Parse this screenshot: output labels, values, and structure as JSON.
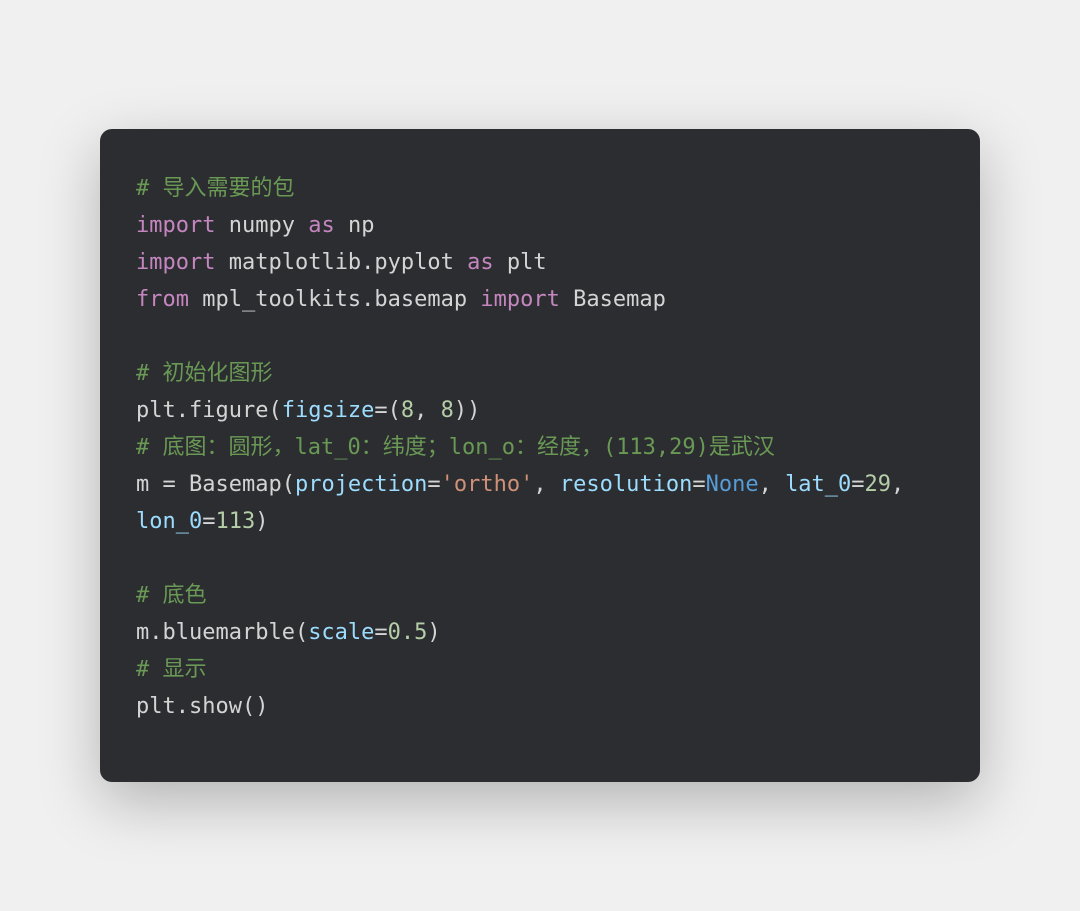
{
  "code": {
    "lines": [
      {
        "tokens": [
          {
            "cls": "comment",
            "text": "# 导入需要的包"
          }
        ]
      },
      {
        "tokens": [
          {
            "cls": "keyword",
            "text": "import"
          },
          {
            "cls": "default",
            "text": " numpy "
          },
          {
            "cls": "keyword",
            "text": "as"
          },
          {
            "cls": "default",
            "text": " np"
          }
        ]
      },
      {
        "tokens": [
          {
            "cls": "keyword",
            "text": "import"
          },
          {
            "cls": "default",
            "text": " matplotlib.pyplot "
          },
          {
            "cls": "keyword",
            "text": "as"
          },
          {
            "cls": "default",
            "text": " plt"
          }
        ]
      },
      {
        "tokens": [
          {
            "cls": "keyword",
            "text": "from"
          },
          {
            "cls": "default",
            "text": " mpl_toolkits.basemap "
          },
          {
            "cls": "keyword",
            "text": "import"
          },
          {
            "cls": "default",
            "text": " Basemap"
          }
        ]
      },
      {
        "tokens": [
          {
            "cls": "default",
            "text": ""
          }
        ]
      },
      {
        "tokens": [
          {
            "cls": "comment",
            "text": "# 初始化图形"
          }
        ]
      },
      {
        "tokens": [
          {
            "cls": "default",
            "text": "plt.figure("
          },
          {
            "cls": "param",
            "text": "figsize"
          },
          {
            "cls": "default",
            "text": "=("
          },
          {
            "cls": "number",
            "text": "8"
          },
          {
            "cls": "default",
            "text": ", "
          },
          {
            "cls": "number",
            "text": "8"
          },
          {
            "cls": "default",
            "text": "))"
          }
        ]
      },
      {
        "tokens": [
          {
            "cls": "comment",
            "text": "# 底图：圆形，lat_0：纬度；lon_o：经度，(113,29)是武汉"
          }
        ]
      },
      {
        "tokens": [
          {
            "cls": "default",
            "text": "m = Basemap("
          },
          {
            "cls": "param",
            "text": "projection"
          },
          {
            "cls": "default",
            "text": "="
          },
          {
            "cls": "string",
            "text": "'ortho'"
          },
          {
            "cls": "default",
            "text": ", "
          },
          {
            "cls": "param",
            "text": "resolution"
          },
          {
            "cls": "default",
            "text": "="
          },
          {
            "cls": "const",
            "text": "None"
          },
          {
            "cls": "default",
            "text": ", "
          },
          {
            "cls": "param",
            "text": "lat_0"
          },
          {
            "cls": "default",
            "text": "="
          },
          {
            "cls": "number",
            "text": "29"
          },
          {
            "cls": "default",
            "text": ", "
          },
          {
            "cls": "param",
            "text": "lon_0"
          },
          {
            "cls": "default",
            "text": "="
          },
          {
            "cls": "number",
            "text": "113"
          },
          {
            "cls": "default",
            "text": ")"
          }
        ]
      },
      {
        "tokens": [
          {
            "cls": "default",
            "text": ""
          }
        ]
      },
      {
        "tokens": [
          {
            "cls": "comment",
            "text": "# 底色"
          }
        ]
      },
      {
        "tokens": [
          {
            "cls": "default",
            "text": "m.bluemarble("
          },
          {
            "cls": "param",
            "text": "scale"
          },
          {
            "cls": "default",
            "text": "="
          },
          {
            "cls": "number",
            "text": "0.5"
          },
          {
            "cls": "default",
            "text": ")"
          }
        ]
      },
      {
        "tokens": [
          {
            "cls": "comment",
            "text": "# 显示"
          }
        ]
      },
      {
        "tokens": [
          {
            "cls": "default",
            "text": "plt.show()"
          }
        ]
      }
    ]
  }
}
